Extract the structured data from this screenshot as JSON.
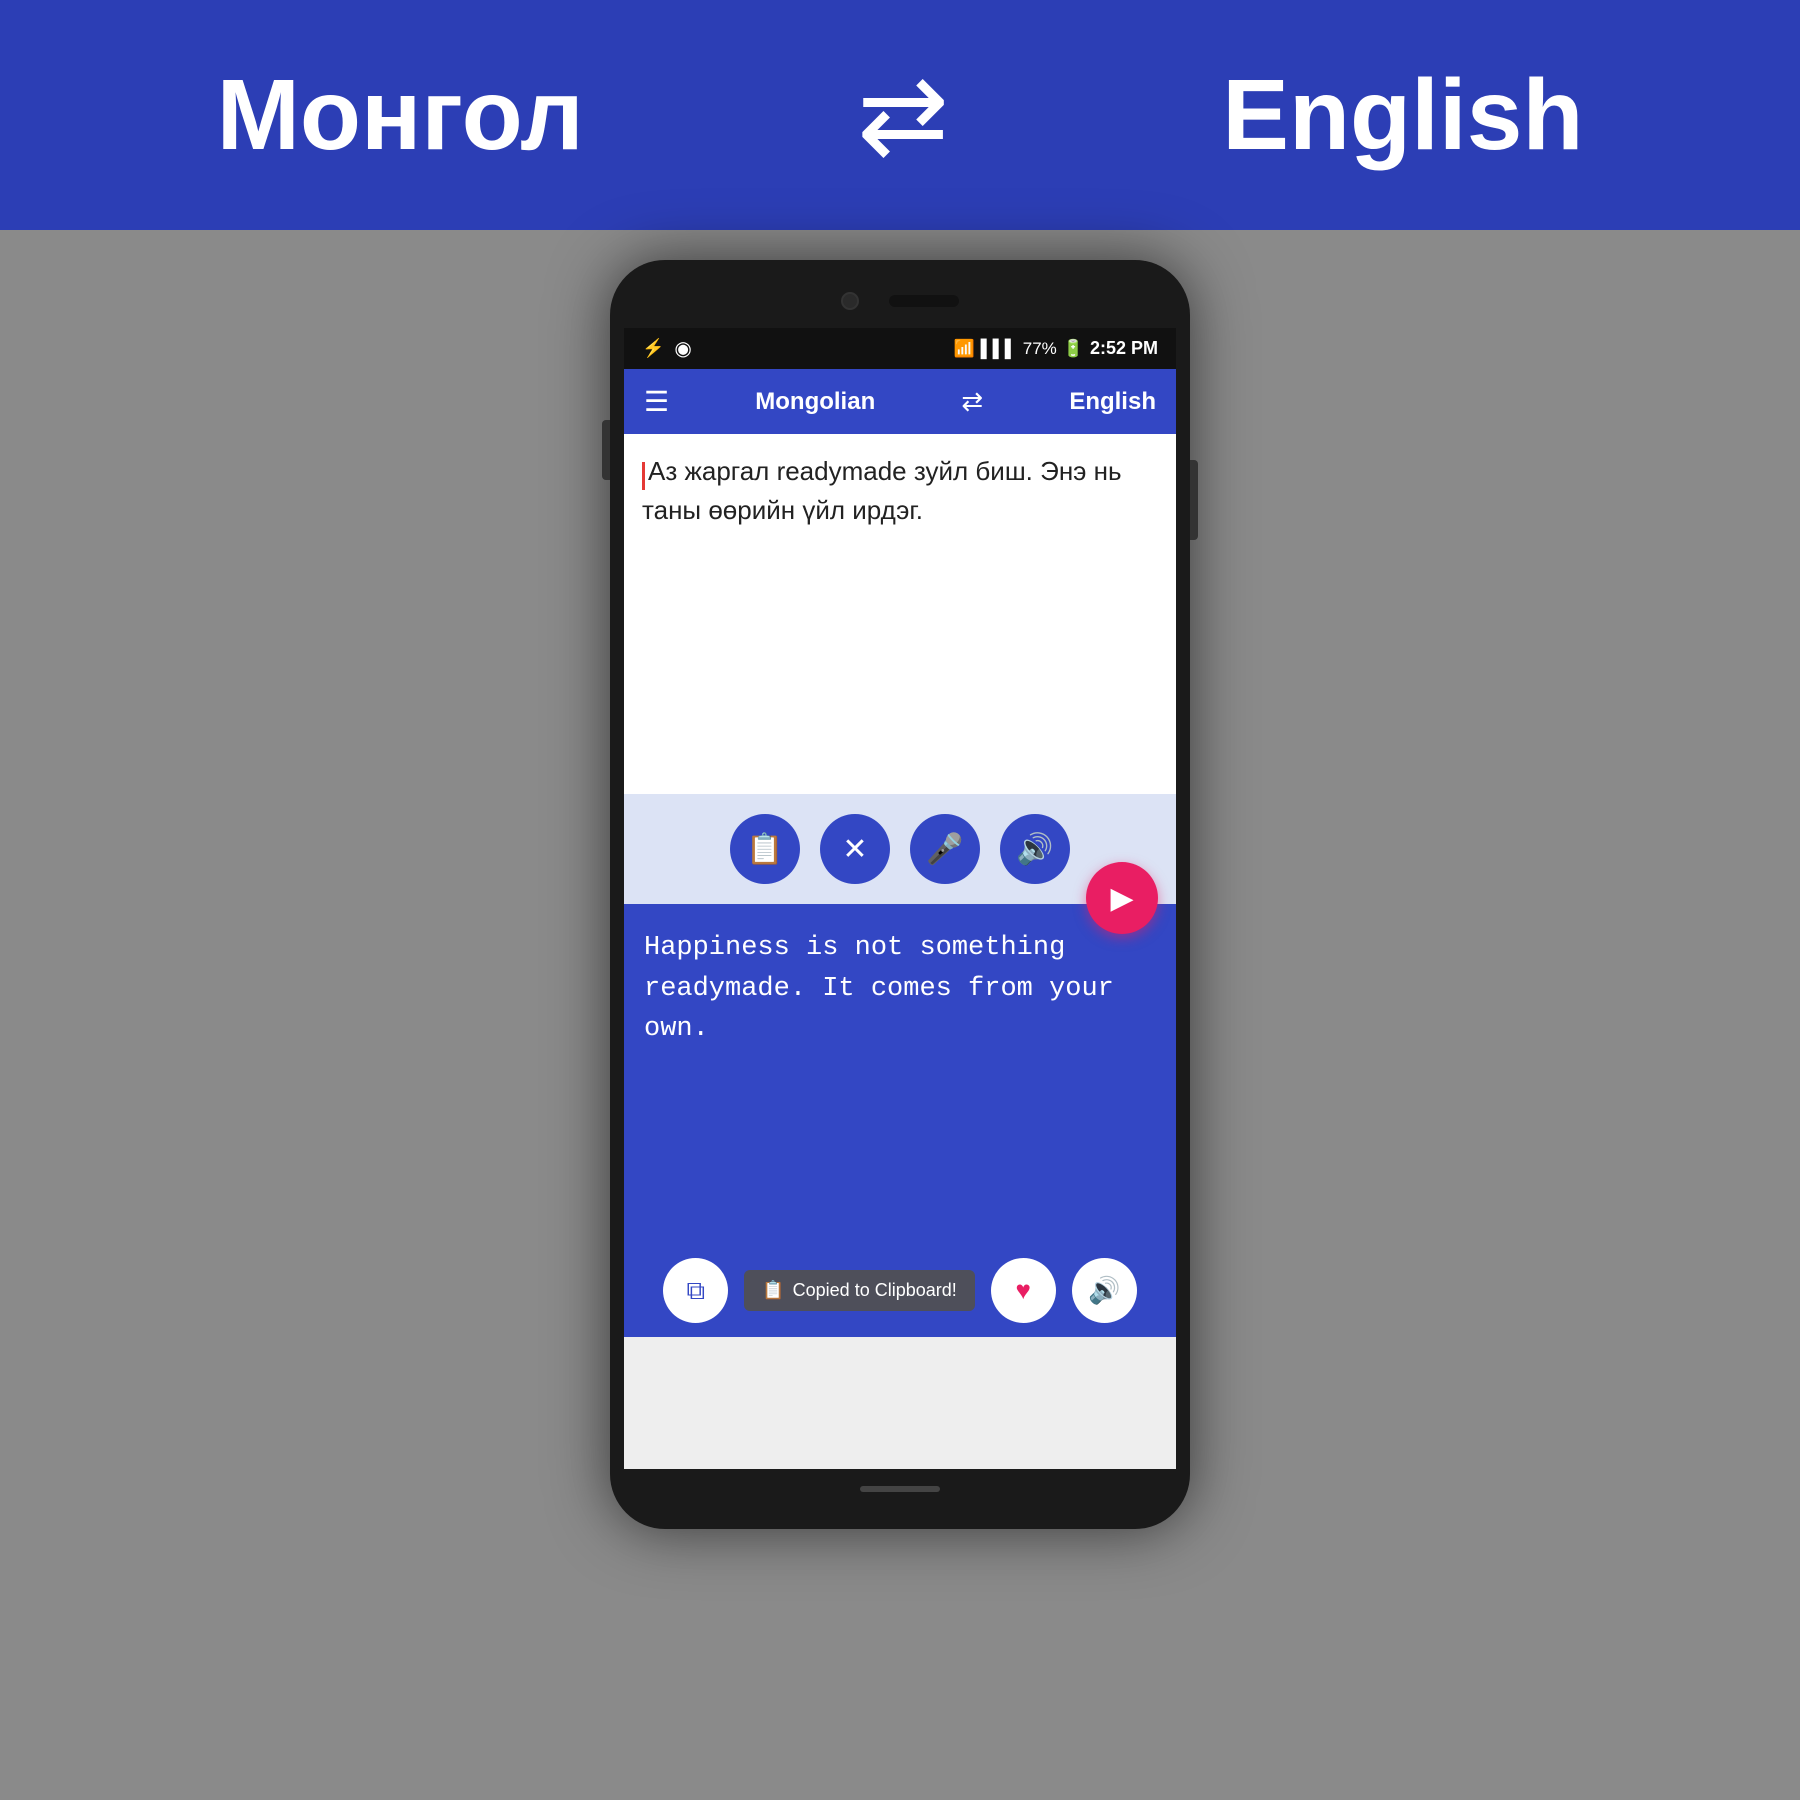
{
  "header": {
    "lang_left": "Монгол",
    "swap_icon": "⇄",
    "lang_right": "English",
    "bg_color": "#2c3eb5"
  },
  "phone": {
    "status_bar": {
      "usb_icon": "⚡",
      "circle_icon": "⊙",
      "wifi_icon": "wifi",
      "signal_icon": "signal",
      "battery": "77%",
      "time": "2:52 PM"
    },
    "toolbar": {
      "menu_icon": "☰",
      "lang_left": "Mongolian",
      "swap_icon": "⇄",
      "lang_right": "English"
    },
    "input": {
      "text": "Аз жаргал readymade зуйл биш. Энэ нь таны өөрийн үйл ирдэг."
    },
    "action_buttons": {
      "clipboard": "📋",
      "close": "✕",
      "mic": "🎤",
      "speaker": "🔊",
      "send": "▶"
    },
    "output": {
      "text": "Happiness is not something readymade. It comes from your own."
    },
    "bottom_bar": {
      "copy_icon": "⧉",
      "share_icon": "↑",
      "heart_icon": "♥",
      "volume_icon": "🔊",
      "toast": "Copied to Clipboard!"
    }
  }
}
